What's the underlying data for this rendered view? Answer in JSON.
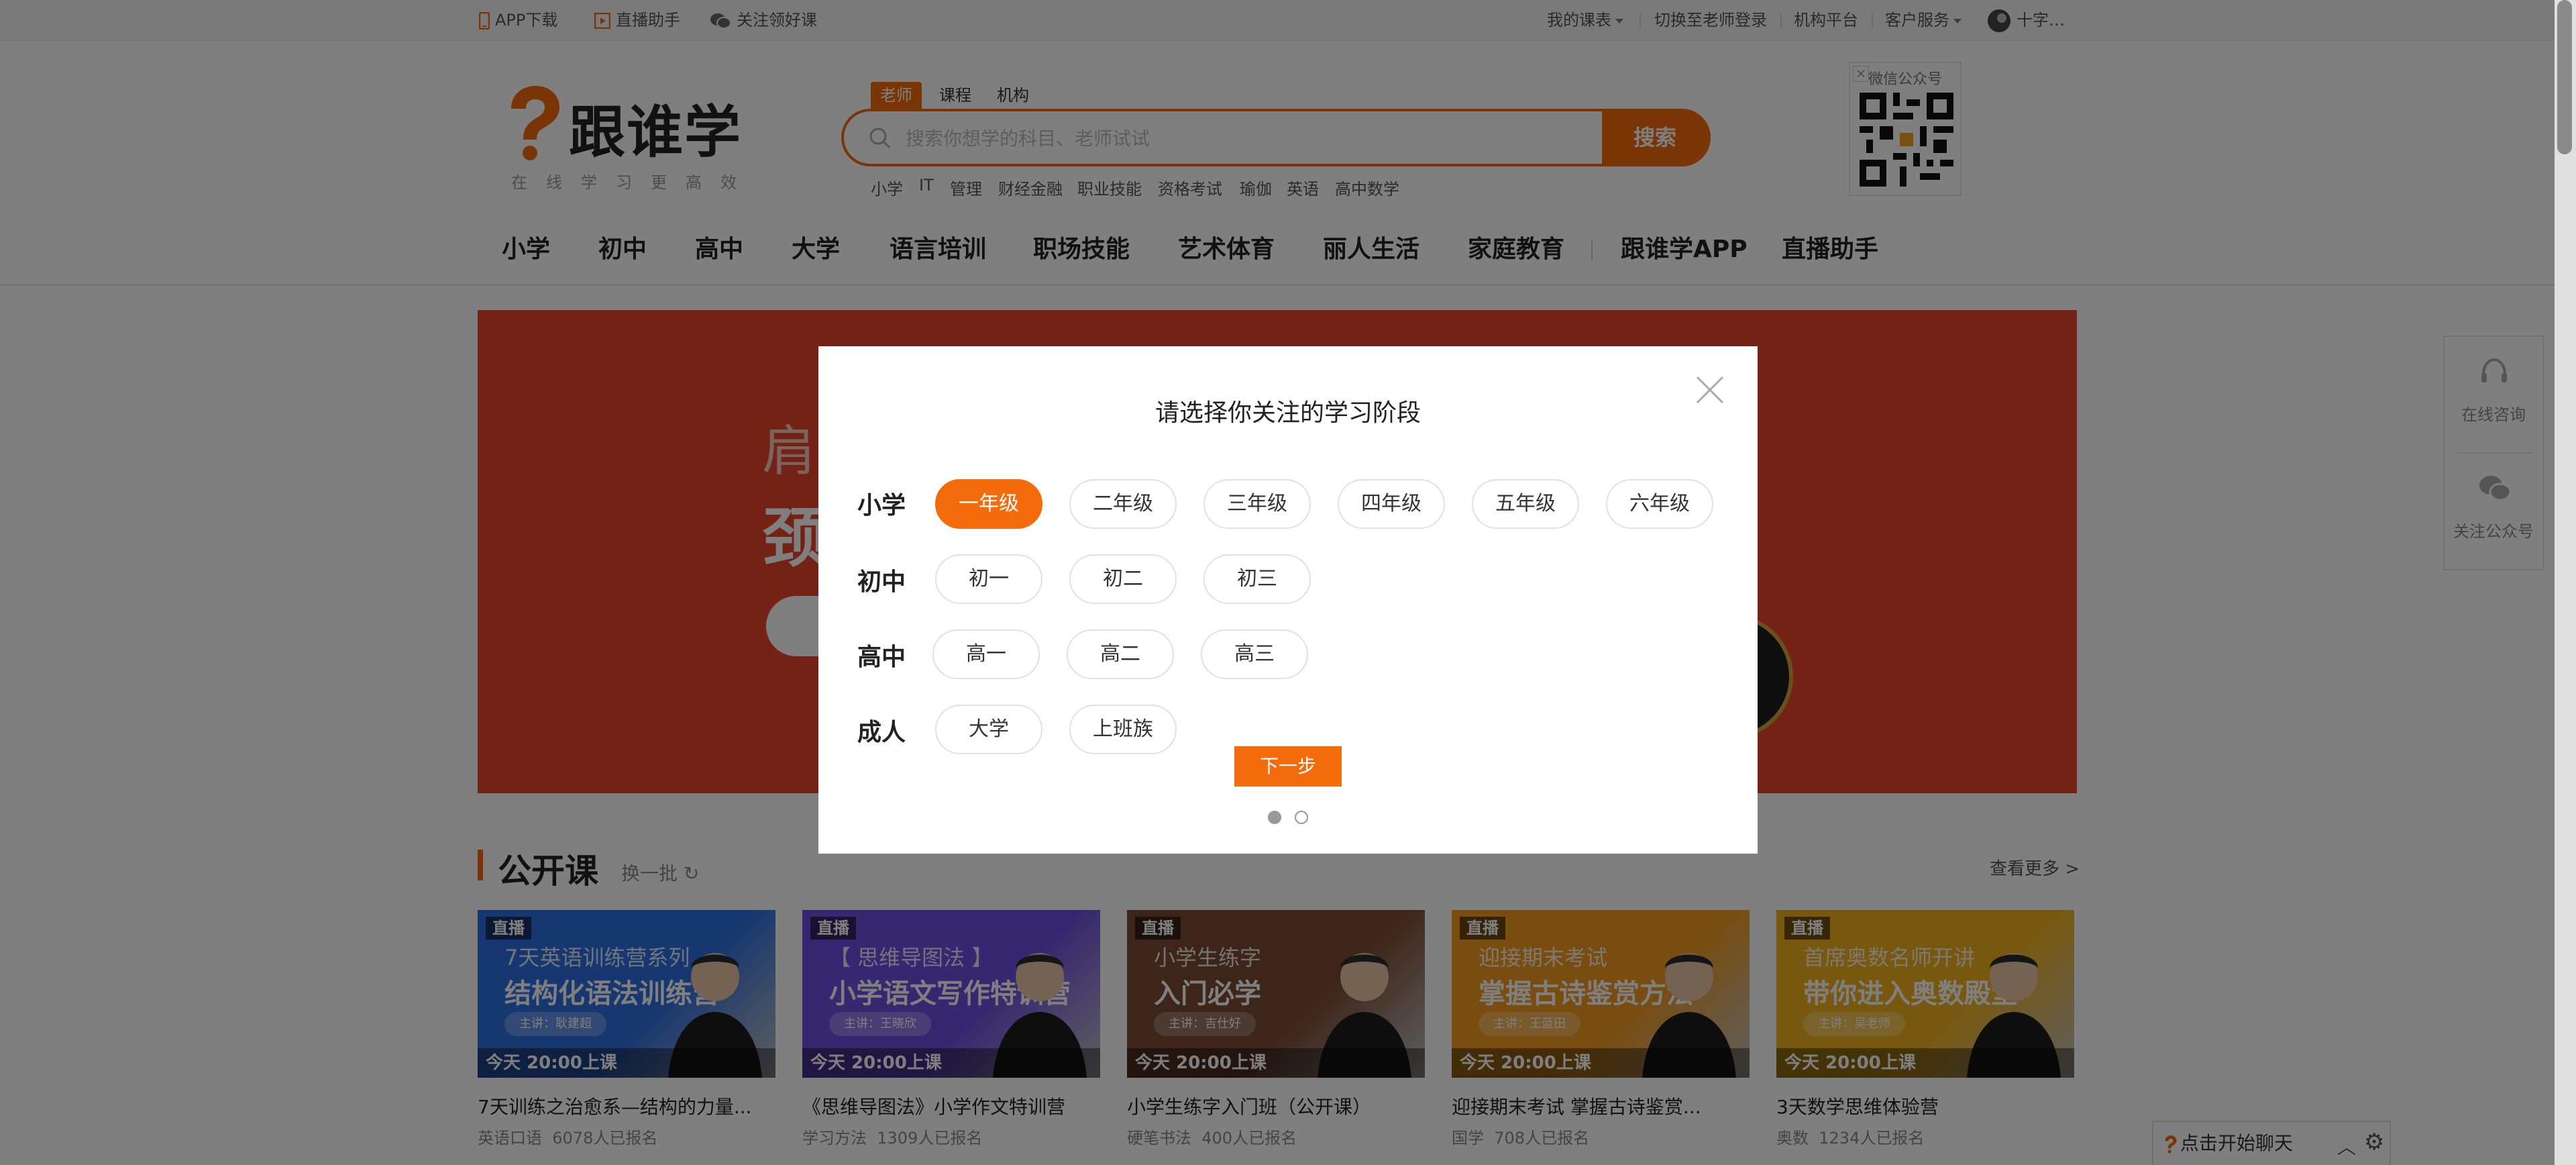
{
  "topbar": {
    "app_download": "APP下载",
    "live_helper": "直播助手",
    "follow_gift": "关注领好课",
    "my_courses": "我的课表",
    "switch_teacher": "切换至老师登录",
    "org_platform": "机构平台",
    "customer_service": "客户服务",
    "username": "十字…"
  },
  "header": {
    "logo": "跟谁学",
    "slogan": "在线学习更高效",
    "search_tabs": [
      "老师",
      "课程",
      "机构"
    ],
    "search_placeholder": "搜索你想学的科目、老师试试",
    "search_button": "搜索",
    "hot_keywords": [
      "小学",
      "IT",
      "管理",
      "财经金融",
      "职业技能",
      "资格考试",
      "瑜伽",
      "英语",
      "高中数学"
    ],
    "wechat_title": "微信公众号",
    "wechat_close": "×"
  },
  "nav": {
    "items": [
      "小学",
      "初中",
      "高中",
      "大学",
      "语言培训",
      "职场技能",
      "艺术体育",
      "丽人生活",
      "家庭教育"
    ],
    "extra": [
      "跟谁学APP",
      "直播助手"
    ]
  },
  "banner": {
    "line1": "肩",
    "line2": "颈"
  },
  "side": {
    "consult": "在线咨询",
    "follow": "关注公众号"
  },
  "courses_section": {
    "title": "公开课",
    "refresh": "换一批",
    "more": "查看更多 >",
    "items": [
      {
        "tag": "直播",
        "sub": "7天英语训练营系列",
        "head": "结构化语法训练营",
        "lecturer": "主讲：耿建超",
        "time": "今天 20:00上课",
        "title": "7天训练之治愈系—结构的力量...",
        "category": "英语口语",
        "enrolled": "6078人已报名",
        "color": "#2f6ee0"
      },
      {
        "tag": "直播",
        "sub": "【 思维导图法 】",
        "head": "小学语文写作特训营",
        "lecturer": "主讲：王晓欣",
        "time": "今天 20:00上课",
        "title": "《思维导图法》小学作文特训营",
        "category": "学习方法",
        "enrolled": "1309人已报名",
        "color": "#6c4fe0"
      },
      {
        "tag": "直播",
        "sub": "小学生练字",
        "head": "入门必学",
        "lecturer": "主讲：吉仕好",
        "time": "今天 20:00上课",
        "title": "小学生练字入门班（公开课）",
        "category": "硬笔书法",
        "enrolled": "400人已报名",
        "color": "#7a4a33"
      },
      {
        "tag": "直播",
        "sub": "迎接期末考试",
        "head": "掌握古诗鉴赏方法",
        "lecturer": "主讲：王蓝田",
        "time": "今天 20:00上课",
        "title": "迎接期末考试 掌握古诗鉴赏...",
        "category": "国学",
        "enrolled": "708人已报名",
        "color": "#f09a1e"
      },
      {
        "tag": "直播",
        "sub": "首席奥数名师开讲",
        "head": "带你进入奥数殿堂",
        "lecturer": "主讲：吴老师",
        "time": "今天 20:00上课",
        "title": "3天数学思维体验营",
        "category": "奥数",
        "enrolled": "1234人已报名",
        "color": "#f0b11e"
      }
    ]
  },
  "chat": {
    "label": "点击开始聊天"
  },
  "modal": {
    "title": "请选择你关注的学习阶段",
    "groups": [
      {
        "label": "小学",
        "options": [
          "一年级",
          "二年级",
          "三年级",
          "四年级",
          "五年级",
          "六年级"
        ]
      },
      {
        "label": "初中",
        "options": [
          "初一",
          "初二",
          "初三"
        ]
      },
      {
        "label": "高中",
        "options": [
          "高一",
          "高二",
          "高三"
        ]
      },
      {
        "label": "成人",
        "options": [
          "大学",
          "上班族"
        ]
      }
    ],
    "selected": "一年级",
    "next": "下一步",
    "pages": 2,
    "current_page": 1
  },
  "colors": {
    "accent": "#f46b0c",
    "banner": "#e9442b"
  }
}
